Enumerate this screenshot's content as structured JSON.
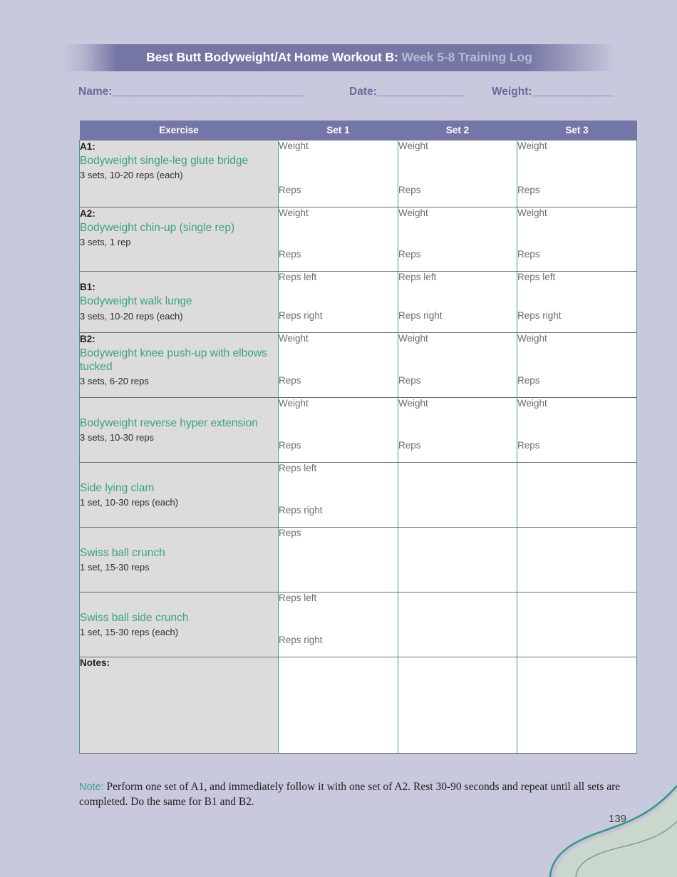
{
  "page": {
    "background_color": "#c9c9de",
    "page_number": "139"
  },
  "header": {
    "title_bold": "Best Butt Bodyweight/At Home",
    "title_mid": " Workout B:",
    "title_sub": " Week 5-8 Training Log",
    "banner_color": "#7676a5"
  },
  "fields": {
    "name_label": "Name:",
    "name_rule": "_________________________________",
    "date_label": "Date:",
    "date_rule": "_______________",
    "weight_label": "Weight:",
    "weight_rule": "______________"
  },
  "table": {
    "columns": [
      "Exercise",
      "Set 1",
      "Set 2",
      "Set 3"
    ],
    "header_bg": "#7576a8",
    "exercise_name_color": "#3aa283",
    "border_color": "#3f9e82",
    "rows": [
      {
        "code": "A1:",
        "name": "Bodyweight single-leg glute bridge",
        "detail": "3 sets, 10-20 reps (each)",
        "set1_top": "Weight",
        "set1_bottom": "Reps",
        "set2_top": "Weight",
        "set2_bottom": "Reps",
        "set3_top": "Weight",
        "set3_bottom": "Reps"
      },
      {
        "code": "A2:",
        "name": "Bodyweight chin-up (single rep)",
        "detail": "3 sets, 1 rep",
        "set1_top": "Weight",
        "set1_bottom": "Reps",
        "set2_top": "Weight",
        "set2_bottom": "Reps",
        "set3_top": "Weight",
        "set3_bottom": "Reps"
      },
      {
        "code": "B1:",
        "name": "Bodyweight walk lunge",
        "detail": "3 sets, 10-20 reps (each)",
        "set1_top": "Reps left",
        "set1_bottom": "Reps right",
        "set2_top": "Reps left",
        "set2_bottom": "Reps right",
        "set3_top": "Reps left",
        "set3_bottom": "Reps right"
      },
      {
        "code": "B2:",
        "name": "Bodyweight knee push-up with elbows tucked",
        "detail": "3 sets, 6-20 reps",
        "set1_top": "Weight",
        "set1_bottom": "Reps",
        "set2_top": "Weight",
        "set2_bottom": "Reps",
        "set3_top": "Weight",
        "set3_bottom": "Reps"
      },
      {
        "code": "",
        "name": "Bodyweight reverse hyper extension",
        "detail": "3 sets, 10-30 reps",
        "set1_top": "Weight",
        "set1_bottom": "Reps",
        "set2_top": "Weight",
        "set2_bottom": "Reps",
        "set3_top": "Weight",
        "set3_bottom": "Reps"
      },
      {
        "code": "",
        "name": "Side lying clam",
        "detail": "1 set, 10-30 reps (each)",
        "set1_top": "Reps left",
        "set1_bottom": "Reps right",
        "set2_top": "",
        "set2_bottom": "",
        "set3_top": "",
        "set3_bottom": ""
      },
      {
        "code": "",
        "name": "Swiss ball crunch",
        "detail": "1 set, 15-30 reps",
        "set1_top": "Reps",
        "set1_bottom": "",
        "set2_top": "",
        "set2_bottom": "",
        "set3_top": "",
        "set3_bottom": ""
      },
      {
        "code": "",
        "name": "Swiss ball side crunch",
        "detail": "1 set, 15-30 reps (each)",
        "set1_top": "Reps left",
        "set1_bottom": "Reps right",
        "set2_top": "",
        "set2_bottom": "",
        "set3_top": "",
        "set3_bottom": ""
      }
    ],
    "notes_label": "Notes:"
  },
  "footer": {
    "note_label": "Note:",
    "note_text": " Perform one set of A1, and immediately follow it with one set of A2. Rest 30-90 seconds and repeat until all sets are completed. Do the same for B1 and B2."
  }
}
